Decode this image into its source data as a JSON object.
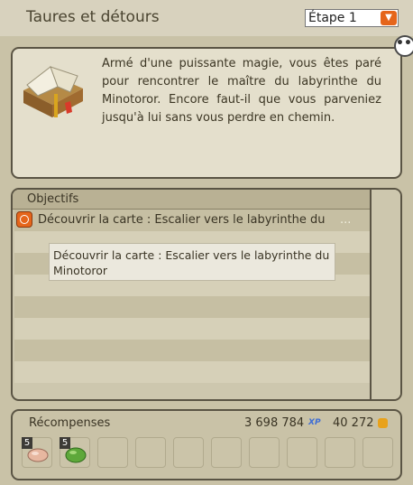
{
  "header": {
    "title": "Taures et détours",
    "step_select": {
      "value": "Étape 1",
      "icon": "chevron-down-icon"
    }
  },
  "description": {
    "icon": "book-icon",
    "text": "Armé d'une puissante magie, vous êtes paré pour rencontrer le maître du labyrinthe du Minotoror. Encore faut-il que vous parveniez jusqu'à lui sans vous perdre en chemin.",
    "chat_icon": "chat-bubble-icon"
  },
  "objectives": {
    "header": "Objectifs",
    "items": [
      {
        "icon": "target-icon",
        "text": "Découvrir la carte : Escalier vers le labyrinthe du",
        "ellipsis": "..."
      }
    ],
    "tooltip": "Découvrir la carte : Escalier vers le labyrinthe du Minotoror"
  },
  "rewards": {
    "label": "Récompenses",
    "xp": "3 698 784",
    "xp_tag": "XP",
    "kamas": "40 272",
    "slots": [
      {
        "qty": "5",
        "icon": "meat-icon"
      },
      {
        "qty": "5",
        "icon": "green-resource-icon"
      },
      {},
      {},
      {},
      {},
      {},
      {},
      {},
      {}
    ]
  },
  "colors": {
    "accent": "#e5651b",
    "panel": "#e4dfcc",
    "border": "#5a5444",
    "xp": "#3f6ed4"
  }
}
